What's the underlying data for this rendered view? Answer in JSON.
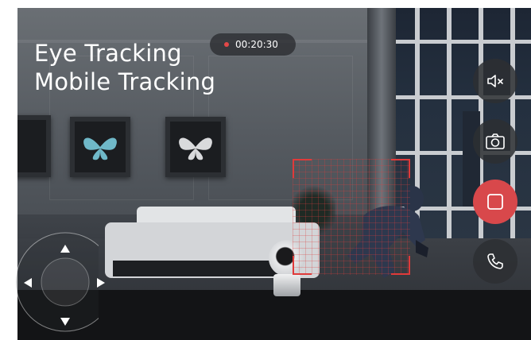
{
  "overlay": {
    "title_line1": "Eye Tracking",
    "title_line2": "Mobile Tracking"
  },
  "recording": {
    "timer": "00:20:30",
    "dot_color": "#e34848"
  },
  "controls": {
    "mute_icon": "speaker-mute-icon",
    "snapshot_icon": "camera-icon",
    "record_icon": "record-stop-icon",
    "call_icon": "phone-icon",
    "record_active_color": "#d8484b"
  },
  "tracking": {
    "box_color": "#e03a3a"
  },
  "joystick": {
    "up_icon": "arrow-up-icon",
    "down_icon": "arrow-down-icon",
    "left_icon": "arrow-left-icon",
    "right_icon": "arrow-right-icon"
  }
}
